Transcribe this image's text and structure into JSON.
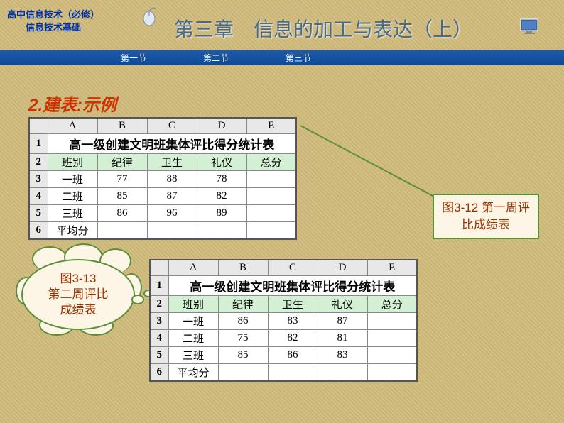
{
  "header": {
    "course_line1": "高中信息技术（必修）",
    "course_line2": "信息技术基础",
    "chapter_title": "第三章　信息的加工与表达（上）"
  },
  "nav": {
    "items": [
      "第一节",
      "第二节",
      "第三节"
    ]
  },
  "section": {
    "number": "2.",
    "label": "建表:",
    "example": "示例"
  },
  "chart_data": [
    {
      "type": "table",
      "title": "高一级创建文明班集体评比得分统计表",
      "columns": [
        "A",
        "B",
        "C",
        "D",
        "E"
      ],
      "headers": [
        "班别",
        "纪律",
        "卫生",
        "礼仪",
        "总分"
      ],
      "rows": [
        {
          "label": "一班",
          "values": [
            77,
            88,
            78,
            ""
          ]
        },
        {
          "label": "二班",
          "values": [
            85,
            87,
            82,
            ""
          ]
        },
        {
          "label": "三班",
          "values": [
            86,
            96,
            89,
            ""
          ]
        },
        {
          "label": "平均分",
          "values": [
            "",
            "",
            "",
            ""
          ]
        }
      ],
      "caption": "图3-12 第一周评比成绩表"
    },
    {
      "type": "table",
      "title": "高一级创建文明班集体评比得分统计表",
      "columns": [
        "A",
        "B",
        "C",
        "D",
        "E"
      ],
      "headers": [
        "班别",
        "纪律",
        "卫生",
        "礼仪",
        "总分"
      ],
      "rows": [
        {
          "label": "一班",
          "values": [
            86,
            83,
            87,
            ""
          ]
        },
        {
          "label": "二班",
          "values": [
            75,
            82,
            81,
            ""
          ]
        },
        {
          "label": "三班",
          "values": [
            85,
            86,
            83,
            ""
          ]
        },
        {
          "label": "平均分",
          "values": [
            "",
            "",
            "",
            ""
          ]
        }
      ],
      "caption_line1": "图3-13",
      "caption_line2": "第二周评比",
      "caption_line3": "成绩表"
    }
  ],
  "row_numbers": [
    "1",
    "2",
    "3",
    "4",
    "5",
    "6"
  ]
}
